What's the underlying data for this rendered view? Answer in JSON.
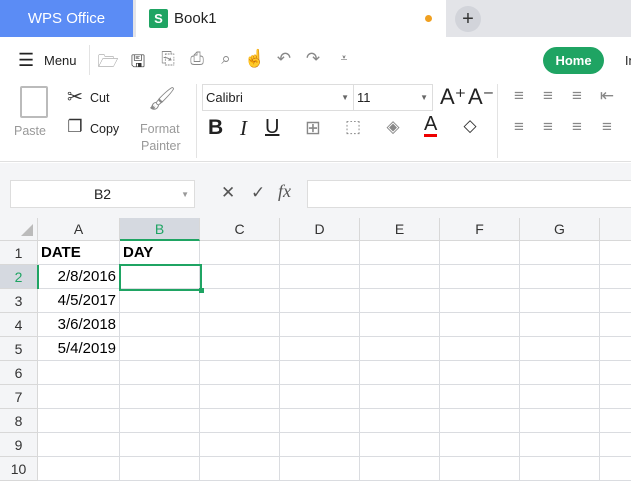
{
  "tabs": {
    "app": "WPS Office",
    "doc": "Book1",
    "doc_icon": "S"
  },
  "toolbar": {
    "menu": "Menu",
    "home": "Home",
    "next_tab": "In"
  },
  "ribbon": {
    "paste": "Paste",
    "cut": "Cut",
    "copy": "Copy",
    "format": "Format",
    "painter": "Painter",
    "font": "Calibri",
    "size": "11",
    "bold": "B",
    "italic": "I",
    "underline": "U",
    "font_color": "A"
  },
  "formula_bar": {
    "name_box": "B2",
    "cancel": "✕",
    "confirm": "✓",
    "fx": "fx",
    "value": ""
  },
  "columns": [
    "A",
    "B",
    "C",
    "D",
    "E",
    "F",
    "G"
  ],
  "rows": [
    "1",
    "2",
    "3",
    "4",
    "5",
    "6",
    "7",
    "8",
    "9",
    "10"
  ],
  "cells": {
    "A1": "DATE",
    "B1": "DAY",
    "A2": "2/8/2016",
    "A3": "4/5/2017",
    "A4": "3/6/2018",
    "A5": "5/4/2019"
  },
  "selection": "B2"
}
